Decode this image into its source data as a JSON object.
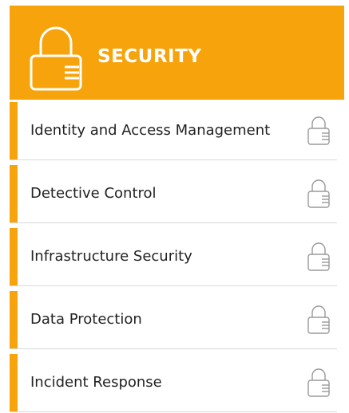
{
  "header": {
    "title": "SECURITY",
    "icon": "lock-icon",
    "background_color": "#f7a30b",
    "text_color": "#ffffff"
  },
  "items": [
    {
      "label": "Identity and Access Management",
      "icon": "lock-icon"
    },
    {
      "label": "Detective Control",
      "icon": "lock-icon"
    },
    {
      "label": "Infrastructure Security",
      "icon": "lock-icon"
    },
    {
      "label": "Data Protection",
      "icon": "lock-icon"
    },
    {
      "label": "Incident Response",
      "icon": "lock-icon"
    }
  ],
  "accent_color": "#f7a30b"
}
